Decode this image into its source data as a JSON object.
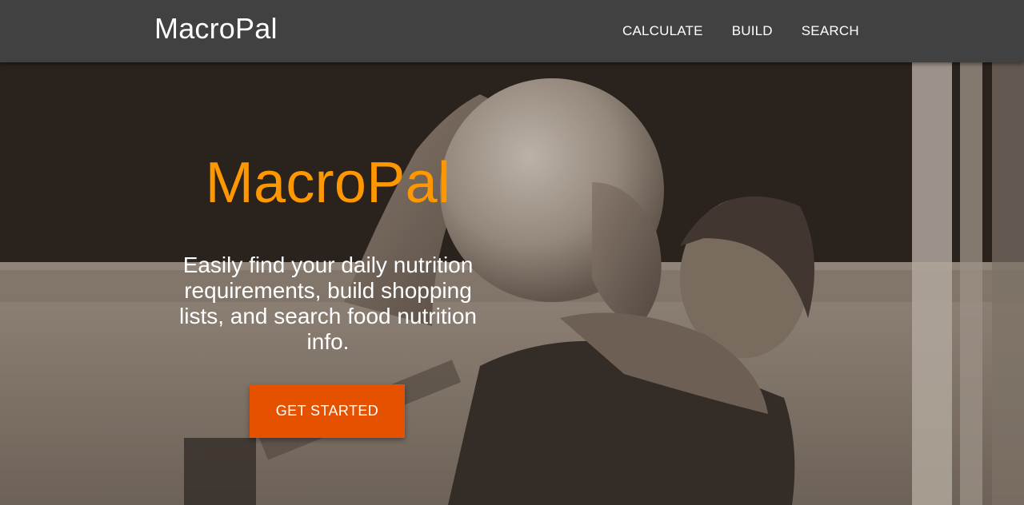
{
  "navbar": {
    "brand": "MacroPal",
    "links": [
      {
        "label": "CALCULATE"
      },
      {
        "label": "BUILD"
      },
      {
        "label": "SEARCH"
      }
    ]
  },
  "hero": {
    "title": "MacroPal",
    "subtitle": "Easily find your daily nutrition requirements, build shopping lists, and search food nutrition info.",
    "cta_label": "GET STARTED"
  },
  "colors": {
    "navbar_bg": "#414141",
    "title_accent": "#ff9800",
    "cta_bg": "#e65100"
  }
}
